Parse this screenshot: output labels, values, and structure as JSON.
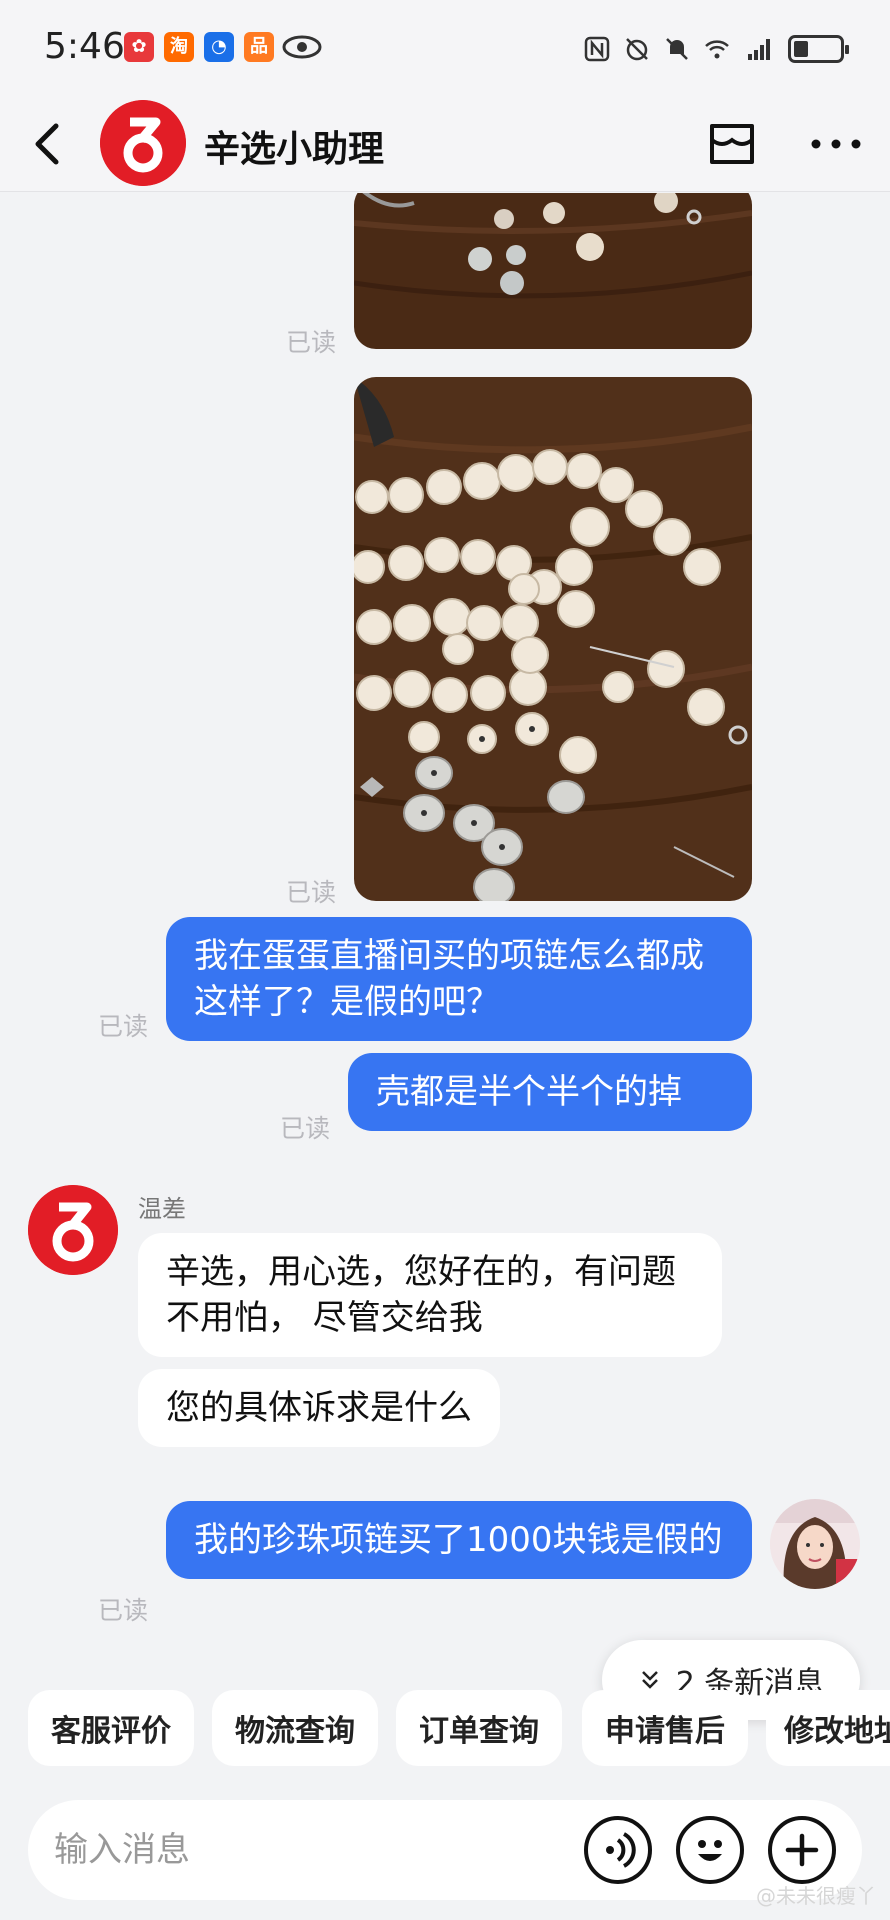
{
  "status_bar": {
    "time": "5:46",
    "app_icons": [
      {
        "name": "app-red-icon",
        "glyph": "✿",
        "color": "#e8393b"
      },
      {
        "name": "taobao-icon",
        "glyph": "淘",
        "color": "#ff6a00"
      },
      {
        "name": "app-blue-icon",
        "glyph": "◔",
        "color": "#1a6fe8"
      },
      {
        "name": "app-orange-icon",
        "glyph": "品",
        "color": "#ff7a22"
      }
    ]
  },
  "header": {
    "title": "辛选小助理"
  },
  "chat": {
    "read_label": "已读",
    "messages": {
      "q1": "我在蛋蛋直播间买的项链怎么都成这样了？是假的吧？",
      "q2": "壳都是半个半个的掉",
      "agent_name": "温差",
      "a1": "辛选，用心选，您好在的，有问题不用怕， 尽管交给我",
      "a2": "您的具体诉求是什么",
      "q3": "我的珍珠项链买了1000块钱是假的"
    },
    "new_messages": "2 条新消息"
  },
  "quick_replies": [
    "客服评价",
    "物流查询",
    "订单查询",
    "申请售后",
    "修改地址"
  ],
  "input": {
    "placeholder": "输入消息"
  },
  "watermark": "@未未很瘦丫",
  "colors": {
    "brand_red": "#e21d26",
    "bubble_blue": "#3775f2"
  }
}
